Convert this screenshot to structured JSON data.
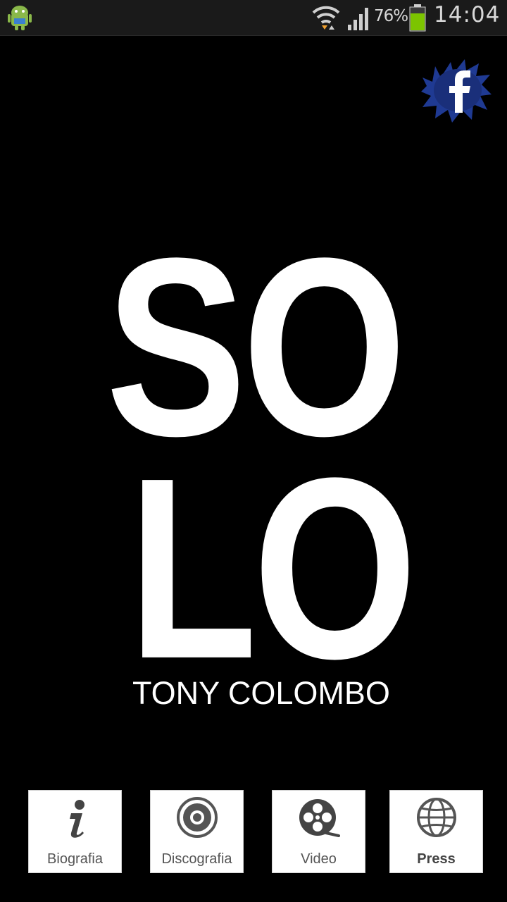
{
  "status_bar": {
    "battery_percent": "76%",
    "battery_level": 0.76,
    "time": "14:04",
    "icons": [
      "android-debug-icon",
      "wifi-icon",
      "signal-icon",
      "battery-icon"
    ],
    "battery_color": "#7cc400"
  },
  "header": {
    "facebook_icon": "facebook-icon",
    "facebook_color": "#1f3a93"
  },
  "logo": {
    "line1": "SO",
    "line2": "LO",
    "artist": "TONY COLOMBO"
  },
  "nav": {
    "items": [
      {
        "label": "Biografia",
        "icon": "info-icon"
      },
      {
        "label": "Discografia",
        "icon": "disc-icon"
      },
      {
        "label": "Video",
        "icon": "film-reel-icon"
      },
      {
        "label": "Press",
        "icon": "globe-icon"
      }
    ]
  }
}
